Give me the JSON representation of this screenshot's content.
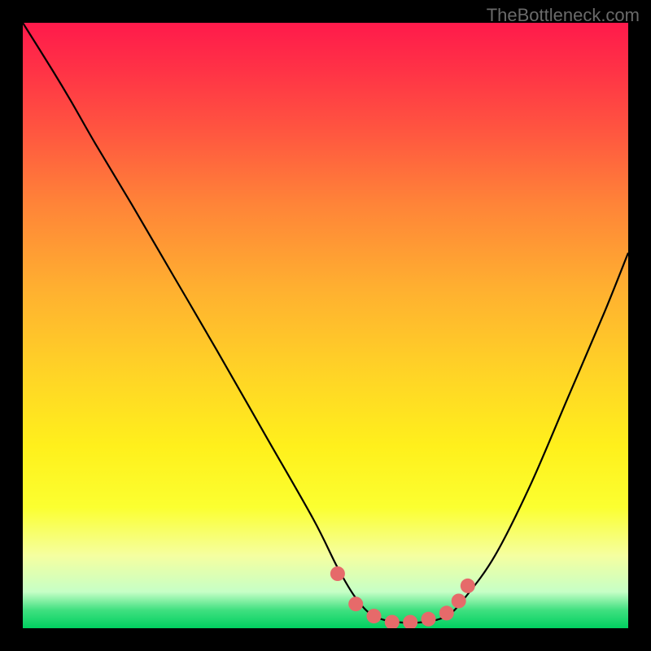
{
  "watermark": "TheBottleneck.com",
  "chart_data": {
    "type": "line",
    "title": "",
    "xlabel": "",
    "ylabel": "",
    "xlim": [
      0,
      100
    ],
    "ylim": [
      0,
      100
    ],
    "series": [
      {
        "name": "curve",
        "color": "#000000",
        "x": [
          0,
          5,
          8,
          12,
          18,
          25,
          32,
          40,
          48,
          52,
          55,
          58,
          62,
          66,
          70,
          73,
          78,
          84,
          90,
          96,
          100
        ],
        "y": [
          100,
          92,
          87,
          80,
          70,
          58,
          46,
          32,
          18,
          10,
          5,
          2,
          1,
          1,
          2,
          5,
          12,
          24,
          38,
          52,
          62
        ]
      }
    ],
    "markers": {
      "name": "trough-markers",
      "color": "#e66a6a",
      "x": [
        52,
        55,
        58,
        61,
        64,
        67,
        70,
        72,
        73.5
      ],
      "y": [
        9,
        4,
        2,
        1,
        1,
        1.5,
        2.5,
        4.5,
        7
      ]
    },
    "background_gradient": {
      "stops": [
        {
          "pos": 0.0,
          "color": "#ff1a4b"
        },
        {
          "pos": 0.18,
          "color": "#ff5640"
        },
        {
          "pos": 0.44,
          "color": "#ffb030"
        },
        {
          "pos": 0.7,
          "color": "#fff01c"
        },
        {
          "pos": 0.88,
          "color": "#f5ffa0"
        },
        {
          "pos": 0.97,
          "color": "#40e080"
        },
        {
          "pos": 1.0,
          "color": "#00d060"
        }
      ]
    }
  }
}
